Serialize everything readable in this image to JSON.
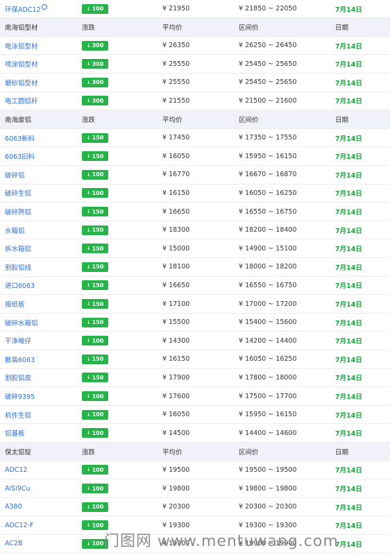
{
  "columns": {
    "change": "涨跌",
    "avg": "平均价",
    "range": "区间价",
    "date": "日期"
  },
  "rows": [
    {
      "type": "item",
      "name": "环保ADC12",
      "verified": true,
      "change": "100",
      "direction": "down",
      "avg": "¥ 21950",
      "range": "¥ 21850 ~ 22050",
      "date": "7月14日"
    },
    {
      "type": "header",
      "name": "南海铝型材"
    },
    {
      "type": "item",
      "name": "电泳铝型材",
      "change": "300",
      "direction": "down",
      "avg": "¥ 26350",
      "range": "¥ 26250 ~ 26450",
      "date": "7月14日"
    },
    {
      "type": "item",
      "name": "喷涂铝型材",
      "change": "300",
      "direction": "down",
      "avg": "¥ 25550",
      "range": "¥ 25450 ~ 25650",
      "date": "7月14日"
    },
    {
      "type": "item",
      "name": "磨砂铝型材",
      "change": "300",
      "direction": "down",
      "avg": "¥ 25550",
      "range": "¥ 25450 ~ 25650",
      "date": "7月14日"
    },
    {
      "type": "item",
      "name": "电工圆铝杆",
      "change": "300",
      "direction": "down",
      "avg": "¥ 21550",
      "range": "¥ 21500 ~ 21600",
      "date": "7月14日"
    },
    {
      "type": "header",
      "name": "南海废铝"
    },
    {
      "type": "item",
      "name": "6063新料",
      "change": "150",
      "direction": "down",
      "avg": "¥ 17450",
      "range": "¥ 17350 ~ 17550",
      "date": "7月14日"
    },
    {
      "type": "item",
      "name": "6063旧料",
      "change": "150",
      "direction": "down",
      "avg": "¥ 16050",
      "range": "¥ 15950 ~ 16150",
      "date": "7月14日"
    },
    {
      "type": "item",
      "name": "破碎铝",
      "change": "100",
      "direction": "down",
      "avg": "¥ 16770",
      "range": "¥ 16670 ~ 16870",
      "date": "7月14日"
    },
    {
      "type": "item",
      "name": "破碎生铝",
      "change": "100",
      "direction": "down",
      "avg": "¥ 16150",
      "range": "¥ 16050 ~ 16250",
      "date": "7月14日"
    },
    {
      "type": "item",
      "name": "破碎熟铝",
      "change": "150",
      "direction": "down",
      "avg": "¥ 16650",
      "range": "¥ 16550 ~ 16750",
      "date": "7月14日"
    },
    {
      "type": "item",
      "name": "水箱铝",
      "change": "150",
      "direction": "down",
      "avg": "¥ 18300",
      "range": "¥ 18200 ~ 18400",
      "date": "7月14日"
    },
    {
      "type": "item",
      "name": "拆水箱铝",
      "change": "150",
      "direction": "down",
      "avg": "¥ 15000",
      "range": "¥ 14900 ~ 15100",
      "date": "7月14日"
    },
    {
      "type": "item",
      "name": "割胶铝线",
      "change": "150",
      "direction": "down",
      "avg": "¥ 18100",
      "range": "¥ 18000 ~ 18200",
      "date": "7月14日"
    },
    {
      "type": "item",
      "name": "进口6063",
      "change": "150",
      "direction": "down",
      "avg": "¥ 16650",
      "range": "¥ 16550 ~ 16750",
      "date": "7月14日"
    },
    {
      "type": "item",
      "name": "报纸板",
      "change": "150",
      "direction": "down",
      "avg": "¥ 17100",
      "range": "¥ 17000 ~ 17200",
      "date": "7月14日"
    },
    {
      "type": "item",
      "name": "破碎水箱铝",
      "change": "150",
      "direction": "down",
      "avg": "¥ 15500",
      "range": "¥ 15400 ~ 15600",
      "date": "7月14日"
    },
    {
      "type": "item",
      "name": "干净喉仔",
      "change": "100",
      "direction": "down",
      "avg": "¥ 14300",
      "range": "¥ 14200 ~ 14400",
      "date": "7月14日"
    },
    {
      "type": "item",
      "name": "散装6063",
      "change": "150",
      "direction": "down",
      "avg": "¥ 16150",
      "range": "¥ 16050 ~ 16250",
      "date": "7月14日"
    },
    {
      "type": "item",
      "name": "割胶铝皮",
      "change": "150",
      "direction": "down",
      "avg": "¥ 17900",
      "range": "¥ 17800 ~ 18000",
      "date": "7月14日"
    },
    {
      "type": "item",
      "name": "破碎9395",
      "change": "100",
      "direction": "down",
      "avg": "¥ 17600",
      "range": "¥ 17500 ~ 17700",
      "date": "7月14日"
    },
    {
      "type": "item",
      "name": "机件生铝",
      "change": "100",
      "direction": "down",
      "avg": "¥ 16050",
      "range": "¥ 15950 ~ 16150",
      "date": "7月14日"
    },
    {
      "type": "item",
      "name": "铝基板",
      "change": "100",
      "direction": "down",
      "avg": "¥ 14500",
      "range": "¥ 14400 ~ 14600",
      "date": "7月14日"
    },
    {
      "type": "header",
      "name": "保太铝锭"
    },
    {
      "type": "item",
      "name": "ADC12",
      "change": "100",
      "direction": "down",
      "avg": "¥ 19500",
      "range": "¥ 19500 ~ 19500",
      "date": "7月14日"
    },
    {
      "type": "item",
      "name": "AlSi9Cu",
      "change": "100",
      "direction": "down",
      "avg": "¥ 19800",
      "range": "¥ 19800 ~ 19800",
      "date": "7月14日"
    },
    {
      "type": "item",
      "name": "A380",
      "change": "100",
      "direction": "down",
      "avg": "¥ 20300",
      "range": "¥ 20300 ~ 20300",
      "date": "7月14日"
    },
    {
      "type": "item",
      "name": "ADC12-F",
      "change": "100",
      "direction": "down",
      "avg": "¥ 19300",
      "range": "¥ 19300 ~ 19300",
      "date": "7月14日"
    },
    {
      "type": "item",
      "name": "AC2B",
      "change": "100",
      "direction": "down",
      "avg": "¥ 19900",
      "range": "¥ 19900 ~ 19900",
      "date": "7月14日"
    }
  ],
  "watermark": "门图网 www.mentuwang.com",
  "colors": {
    "badge": "#27b24a",
    "date": "#1aa63c",
    "link": "#2e6fd0",
    "header_bg": "#f1f1fa"
  }
}
